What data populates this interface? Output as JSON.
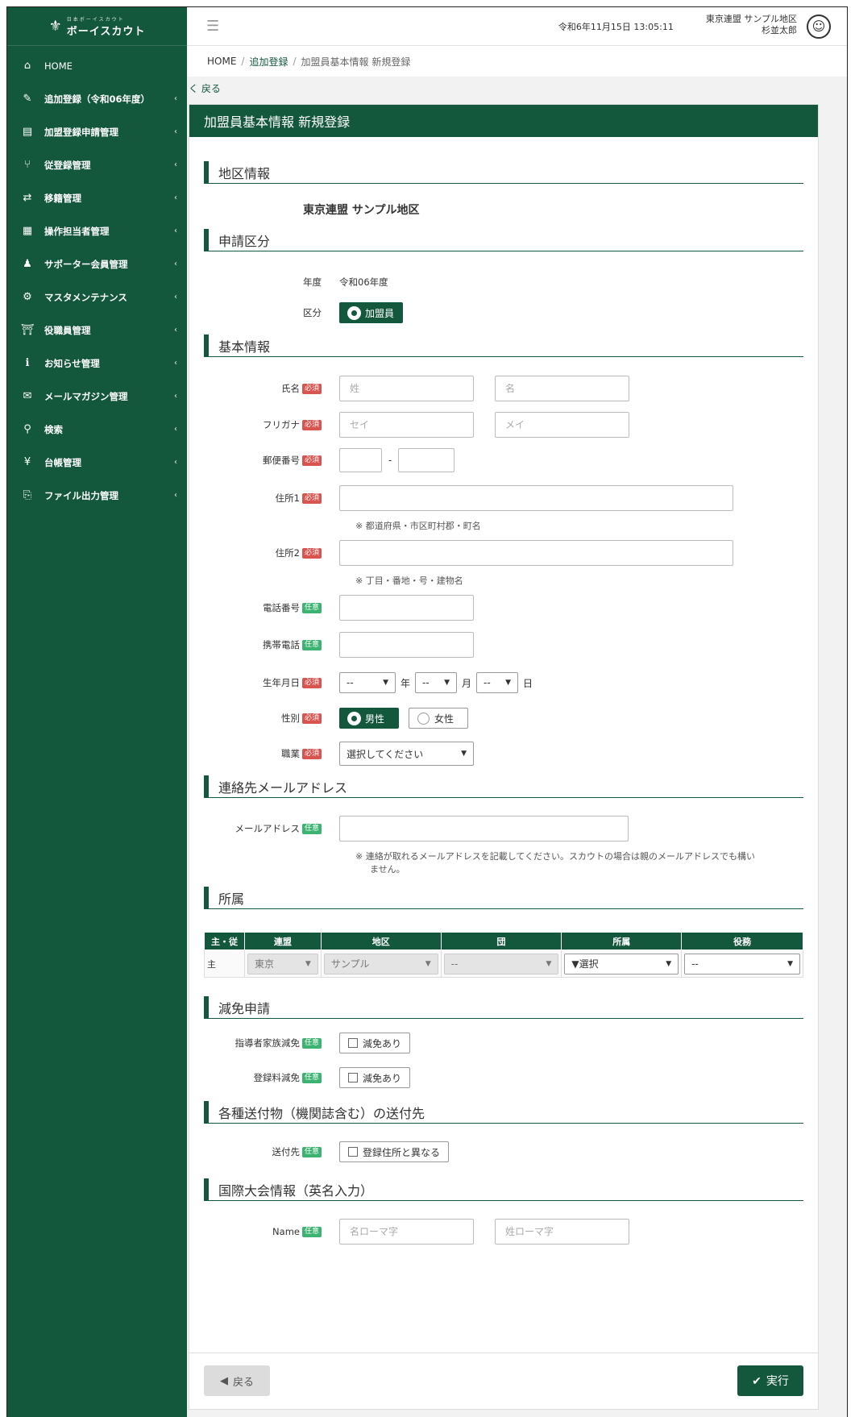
{
  "sidebar": {
    "logo_small": "日本ボーイスカウト",
    "logo_big": "ボーイスカウト",
    "items": [
      {
        "icon": "⌂",
        "label": "HOME",
        "chev": ""
      },
      {
        "icon": "✎",
        "label": "追加登録（令和06年度）",
        "chev": "‹"
      },
      {
        "icon": "▤",
        "label": "加盟登録申請管理",
        "chev": "‹"
      },
      {
        "icon": "⑂",
        "label": "従登録管理",
        "chev": "‹"
      },
      {
        "icon": "⇄",
        "label": "移籍管理",
        "chev": "‹"
      },
      {
        "icon": "▦",
        "label": "操作担当者管理",
        "chev": "‹"
      },
      {
        "icon": "♟",
        "label": "サポーター会員管理",
        "chev": "‹"
      },
      {
        "icon": "⚙",
        "label": "マスタメンテナンス",
        "chev": "‹"
      },
      {
        "icon": "⛩",
        "label": "役職員管理",
        "chev": "‹"
      },
      {
        "icon": "ℹ",
        "label": "お知らせ管理",
        "chev": "‹"
      },
      {
        "icon": "✉",
        "label": "メールマガジン管理",
        "chev": "‹"
      },
      {
        "icon": "⚲",
        "label": "検索",
        "chev": "‹"
      },
      {
        "icon": "¥",
        "label": "台帳管理",
        "chev": "‹"
      },
      {
        "icon": "⎘",
        "label": "ファイル出力管理",
        "chev": "‹"
      }
    ]
  },
  "header": {
    "datetime": "令和6年11月15日 13:05:11",
    "user_org": "東京連盟 サンプル地区",
    "user_name": "杉並太郎"
  },
  "breadcrumb": {
    "home": "HOME",
    "sep": "/",
    "middle": "追加登録",
    "current": "加盟員基本情報 新規登録"
  },
  "back_link": "く 戻る",
  "card_title": "加盟員基本情報 新規登録",
  "badges": {
    "required": "必須",
    "optional": "任意"
  },
  "sections": {
    "district": {
      "title": "地区情報",
      "value": "東京連盟 サンプル地区"
    },
    "application": {
      "title": "申請区分",
      "year_label": "年度",
      "year_value": "令和06年度",
      "kubun_label": "区分",
      "kubun_value": "加盟員"
    },
    "basic": {
      "title": "基本情報",
      "name_label": "氏名",
      "last_name_ph": "姓",
      "first_name_ph": "名",
      "kana_label": "フリガナ",
      "last_kana_ph": "セイ",
      "first_kana_ph": "メイ",
      "zip_label": "郵便番号",
      "zip_sep": "-",
      "addr1_label": "住所1",
      "addr1_note": "※ 都道府県・市区町村郡・町名",
      "addr2_label": "住所2",
      "addr2_note": "※ 丁目・番地・号・建物名",
      "phone_label": "電話番号",
      "mobile_label": "携帯電話",
      "birth_label": "生年月日",
      "birth_year": "--",
      "birth_year_unit": "年",
      "birth_month": "--",
      "birth_month_unit": "月",
      "birth_day": "--",
      "birth_day_unit": "日",
      "gender_label": "性別",
      "gender_male": "男性",
      "gender_female": "女性",
      "job_label": "職業",
      "job_value": "選択してください"
    },
    "email": {
      "title": "連絡先メールアドレス",
      "label": "メールアドレス",
      "note_line1": "※ 連絡が取れるメールアドレスを記載してください。スカウトの場合は親のメールアドレスでも構い",
      "note_line2": "ません。"
    },
    "affiliation": {
      "title": "所属",
      "headers": [
        "主・従",
        "連盟",
        "地区",
        "団",
        "所属",
        "役務"
      ],
      "row": {
        "type": "主",
        "federation": "東京",
        "district": "サンプル",
        "group": "--",
        "belong": "▼選択",
        "role": "--"
      }
    },
    "reduction": {
      "title": "減免申請",
      "family_label": "指導者家族減免",
      "family_check": "減免あり",
      "fee_label": "登録料減免",
      "fee_check": "減免あり"
    },
    "shipping": {
      "title": "各種送付物（機関誌含む）の送付先",
      "label": "送付先",
      "check": "登録住所と異なる"
    },
    "intl": {
      "title": "国際大会情報（英名入力）",
      "label": "Name",
      "first_ph": "名ローマ字",
      "last_ph": "姓ローマ字"
    }
  },
  "footer": {
    "back": "戻る",
    "exec": "実行"
  }
}
